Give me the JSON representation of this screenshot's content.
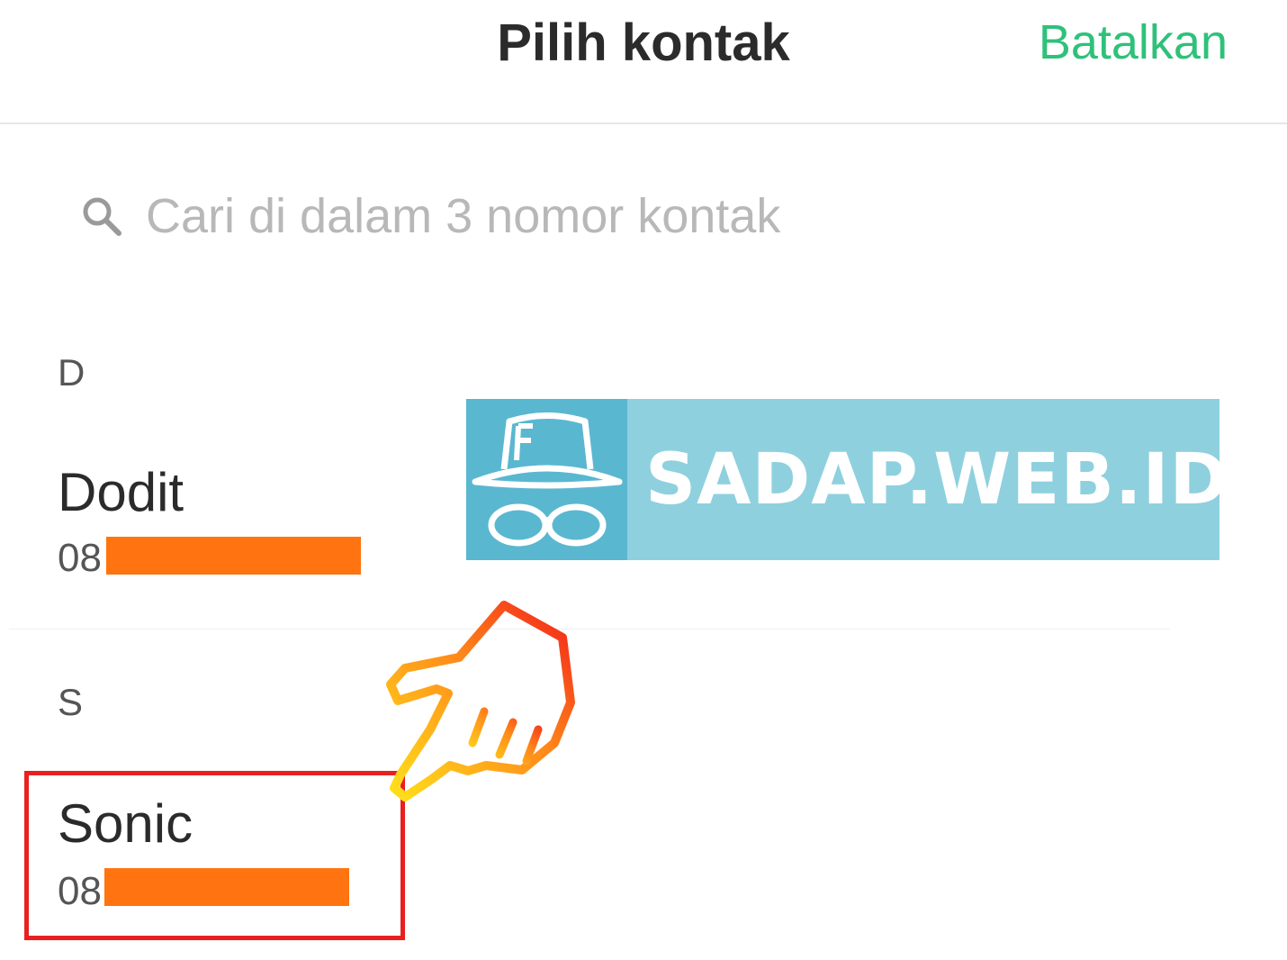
{
  "header": {
    "title": "Pilih kontak",
    "cancel_label": "Batalkan"
  },
  "search": {
    "placeholder": "Cari di dalam 3 nomor kontak",
    "icon": "search-icon"
  },
  "sections": [
    {
      "letter": "D",
      "contacts": [
        {
          "name": "Dodit",
          "phone_prefix": "08",
          "phone_redacted": true
        }
      ]
    },
    {
      "letter": "S",
      "contacts": [
        {
          "name": "Sonic",
          "phone_prefix": "08",
          "phone_redacted": true,
          "highlighted": true
        }
      ]
    }
  ],
  "watermark": {
    "text": "SADAP.WEB.ID",
    "icon": "incognito-hat-glasses-icon"
  },
  "colors": {
    "accent": "#2fc17a",
    "redaction": "#ff7410",
    "highlight_border": "#e8201f",
    "watermark_bg": "#8fd0de",
    "watermark_logo_bg": "#5ab7d0"
  }
}
